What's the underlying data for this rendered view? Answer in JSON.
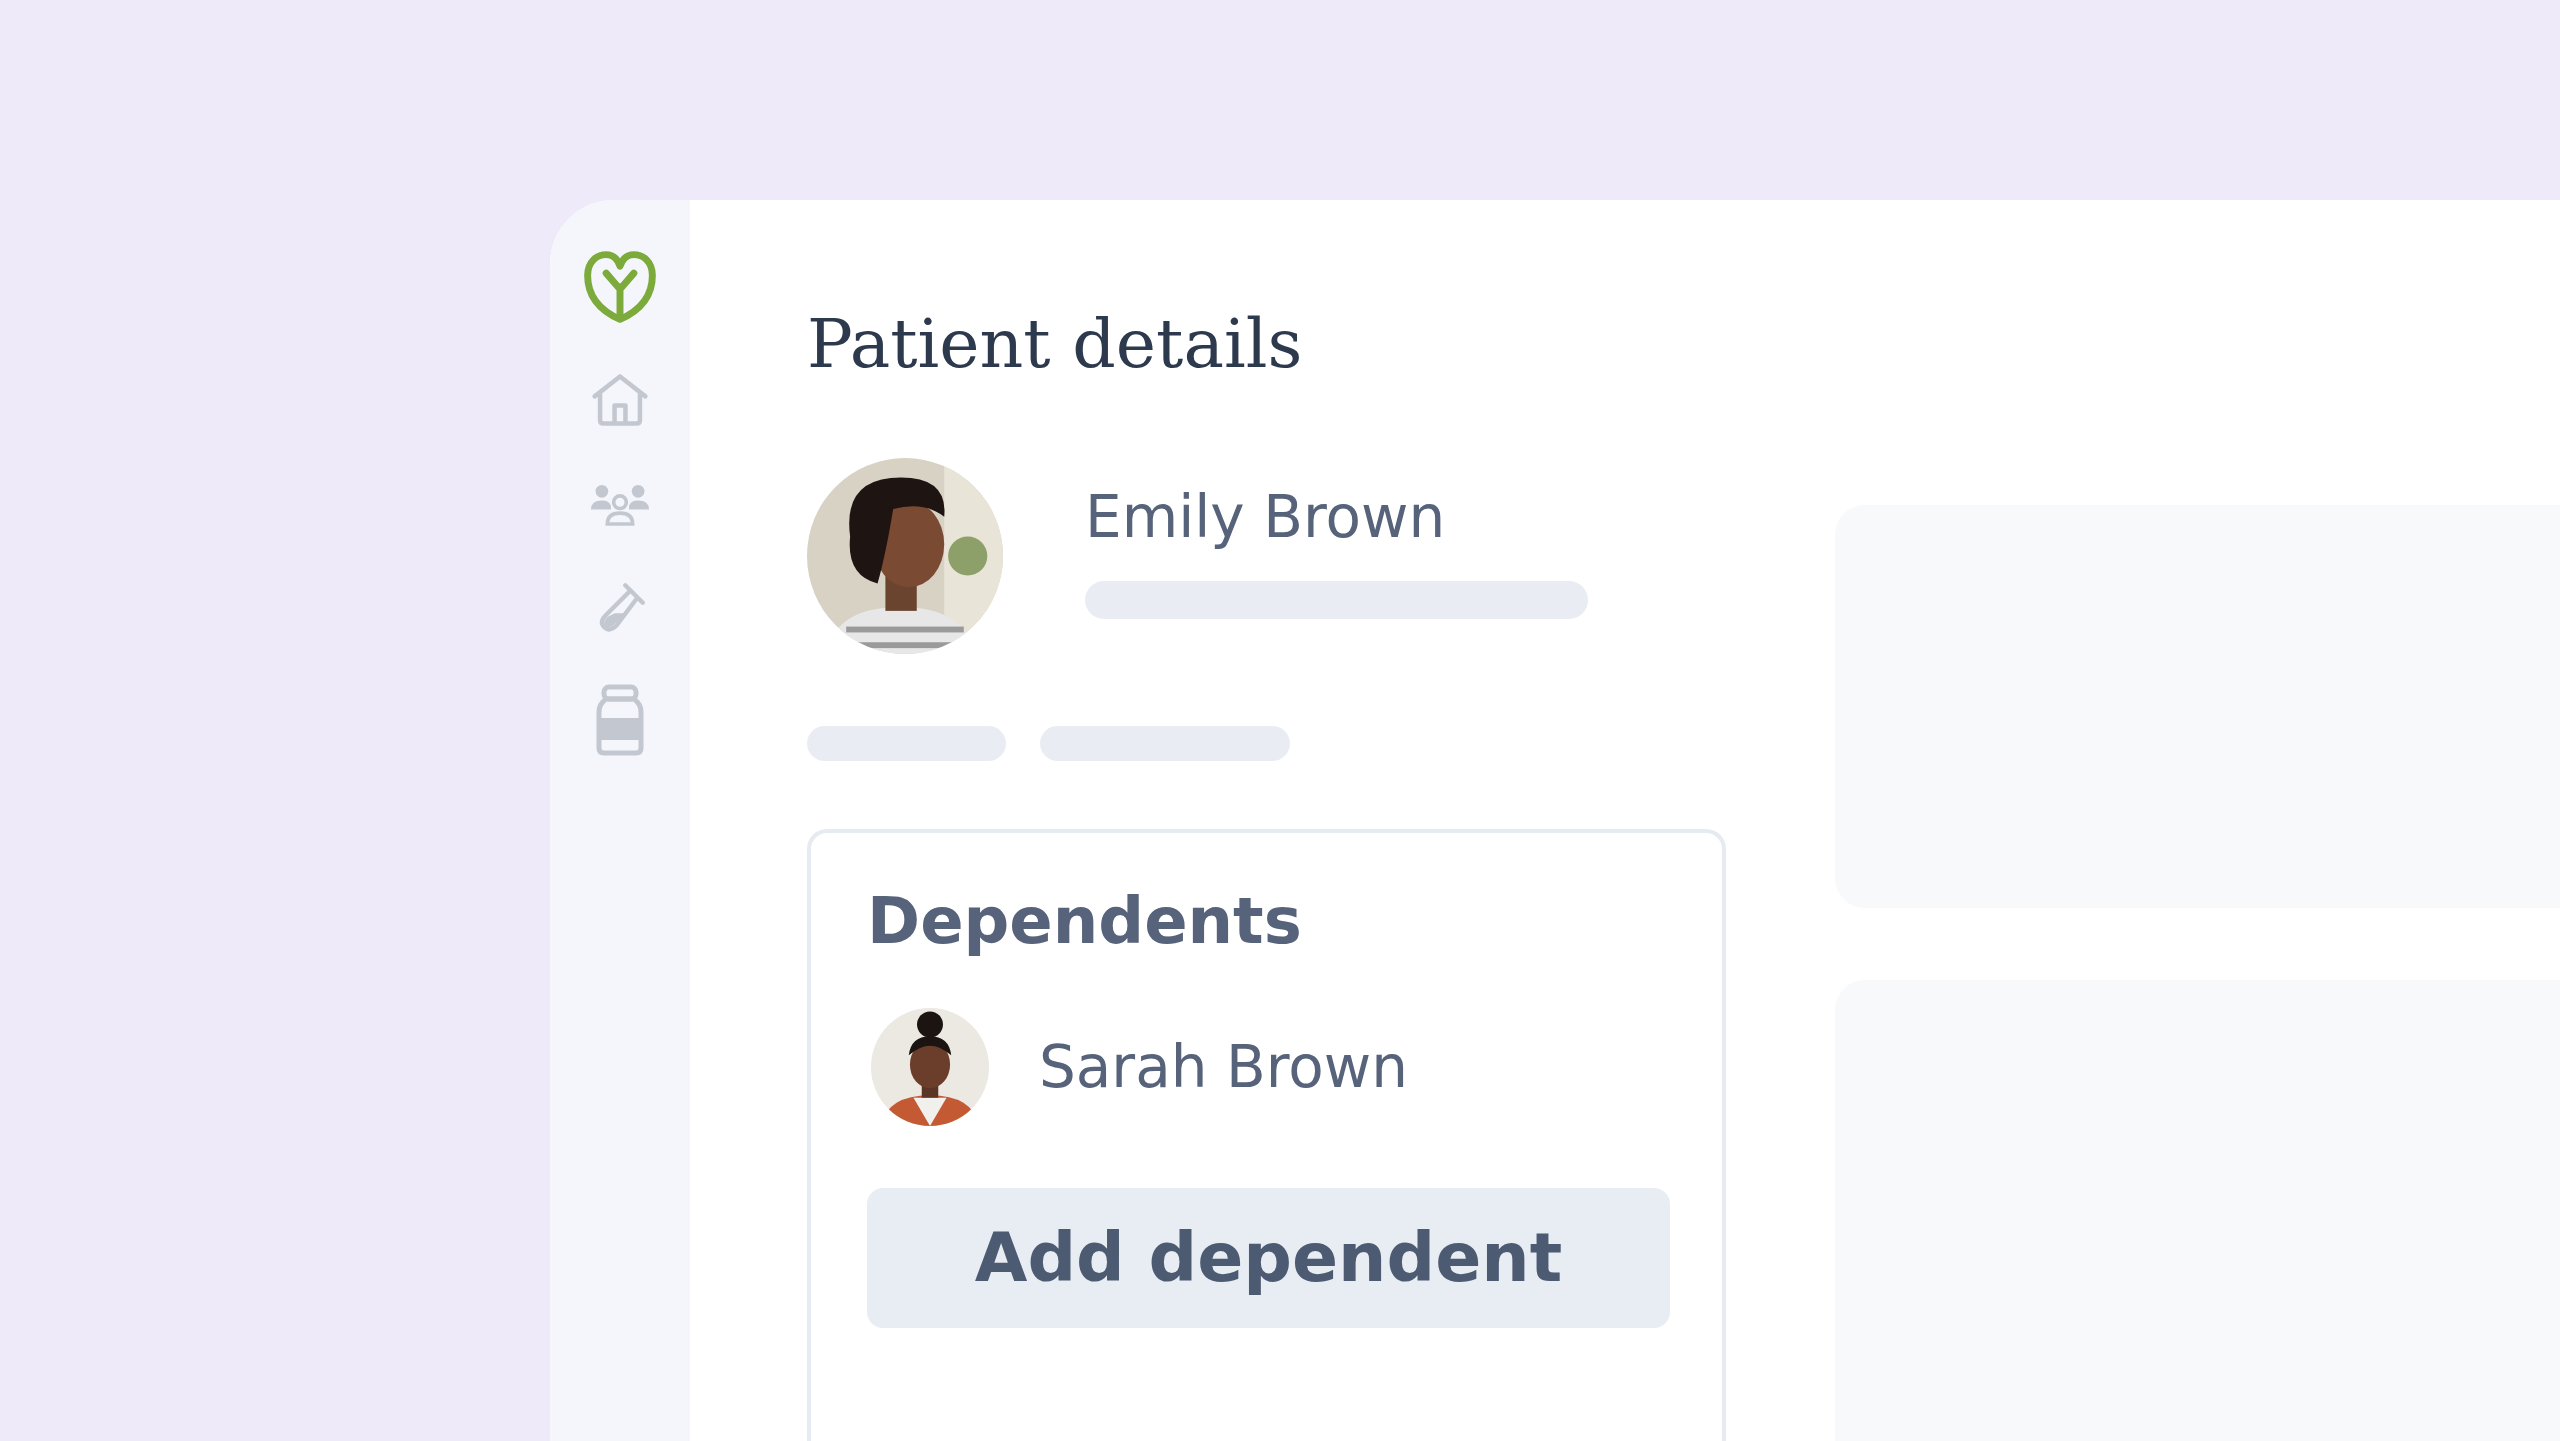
{
  "page_title": "Patient details",
  "patient": {
    "name": "Emily Brown"
  },
  "dependents": {
    "title": "Dependents",
    "items": [
      {
        "name": "Sarah Brown"
      }
    ],
    "add_button": "Add dependent"
  }
}
